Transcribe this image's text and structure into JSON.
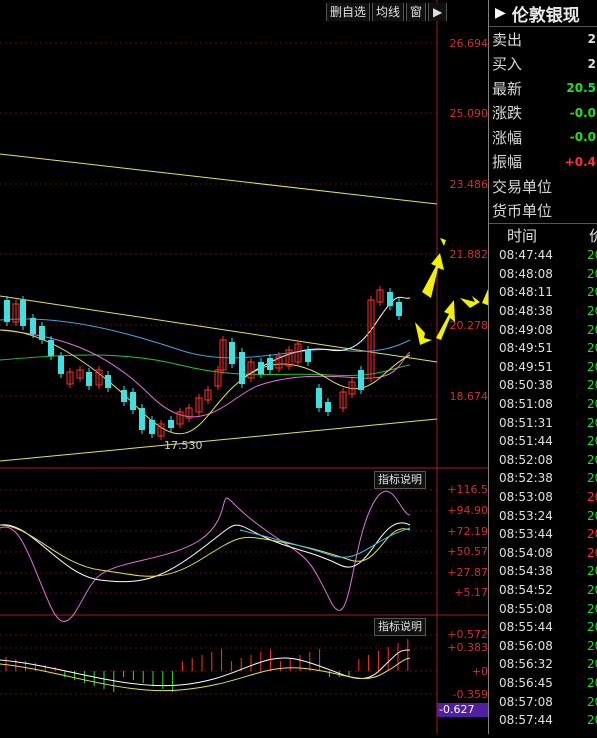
{
  "toolbar": {
    "delete_watch": "删自选",
    "ma_line": "均线",
    "window": "窗",
    "play_icon": "play-icon"
  },
  "main_chart": {
    "price_labels": [
      "26.694",
      "25.090",
      "23.486",
      "21.882",
      "20.278",
      "18.674"
    ],
    "low_marker": "17.530"
  },
  "kdj": {
    "button": "指标说明",
    "labels": [
      "+116.5",
      "+94.90",
      "+72.19",
      "+50.57",
      "+27.87",
      "+5.17"
    ]
  },
  "macd": {
    "button": "指标说明",
    "labels": [
      "+0.572",
      "+0.383",
      "+0",
      "-0.359",
      "-0.627"
    ],
    "cursor_value": "-0.627"
  },
  "quote": {
    "title": "伦敦银现",
    "rows": [
      {
        "label": "卖出",
        "value": "2",
        "color": "#e0e0e0"
      },
      {
        "label": "买入",
        "value": "2",
        "color": "#e0e0e0"
      },
      {
        "label": "最新",
        "value": "20.5",
        "color": "#20e020"
      },
      {
        "label": "涨跌",
        "value": "-0.0",
        "color": "#20e020"
      },
      {
        "label": "涨幅",
        "value": "-0.0",
        "color": "#20e020"
      },
      {
        "label": "振幅",
        "value": "+0.4",
        "color": "#ff3030"
      },
      {
        "label": "交易单位",
        "value": "",
        "color": "#e0e0e0"
      },
      {
        "label": "货币单位",
        "value": "",
        "color": "#e0e0e0"
      }
    ],
    "tick_header": "时间",
    "tick_header_price": "价",
    "ticks": [
      {
        "time": "08:47:44",
        "price": "20",
        "color": "#20e020"
      },
      {
        "time": "08:48:08",
        "price": "20",
        "color": "#20e020"
      },
      {
        "time": "08:48:11",
        "price": "20",
        "color": "#20e020"
      },
      {
        "time": "08:48:38",
        "price": "20",
        "color": "#20e020"
      },
      {
        "time": "08:49:08",
        "price": "20",
        "color": "#20e020"
      },
      {
        "time": "08:49:51",
        "price": "20",
        "color": "#20e020"
      },
      {
        "time": "08:49:51",
        "price": "20",
        "color": "#20e020"
      },
      {
        "time": "08:50:38",
        "price": "20",
        "color": "#20e020"
      },
      {
        "time": "08:51:08",
        "price": "20",
        "color": "#20e020"
      },
      {
        "time": "08:51:31",
        "price": "20",
        "color": "#20e020"
      },
      {
        "time": "08:51:44",
        "price": "20",
        "color": "#20e020"
      },
      {
        "time": "08:52:08",
        "price": "20",
        "color": "#20e020"
      },
      {
        "time": "08:52:38",
        "price": "20",
        "color": "#20e020"
      },
      {
        "time": "08:53:08",
        "price": "20",
        "color": "#ff3030"
      },
      {
        "time": "08:53:24",
        "price": "20",
        "color": "#20e020"
      },
      {
        "time": "08:53:44",
        "price": "20",
        "color": "#ff3030"
      },
      {
        "time": "08:54:08",
        "price": "20",
        "color": "#ff3030"
      },
      {
        "time": "08:54:38",
        "price": "20",
        "color": "#20e020"
      },
      {
        "time": "08:54:52",
        "price": "20",
        "color": "#20e020"
      },
      {
        "time": "08:55:08",
        "price": "20",
        "color": "#20e020"
      },
      {
        "time": "08:55:44",
        "price": "20",
        "color": "#20e020"
      },
      {
        "time": "08:56:08",
        "price": "20",
        "color": "#20e020"
      },
      {
        "time": "08:56:32",
        "price": "20",
        "color": "#20e020"
      },
      {
        "time": "08:56:45",
        "price": "20",
        "color": "#20e020"
      },
      {
        "time": "08:57:08",
        "price": "20",
        "color": "#20e020"
      },
      {
        "time": "08:57:44",
        "price": "20",
        "color": "#20e020"
      }
    ]
  }
}
